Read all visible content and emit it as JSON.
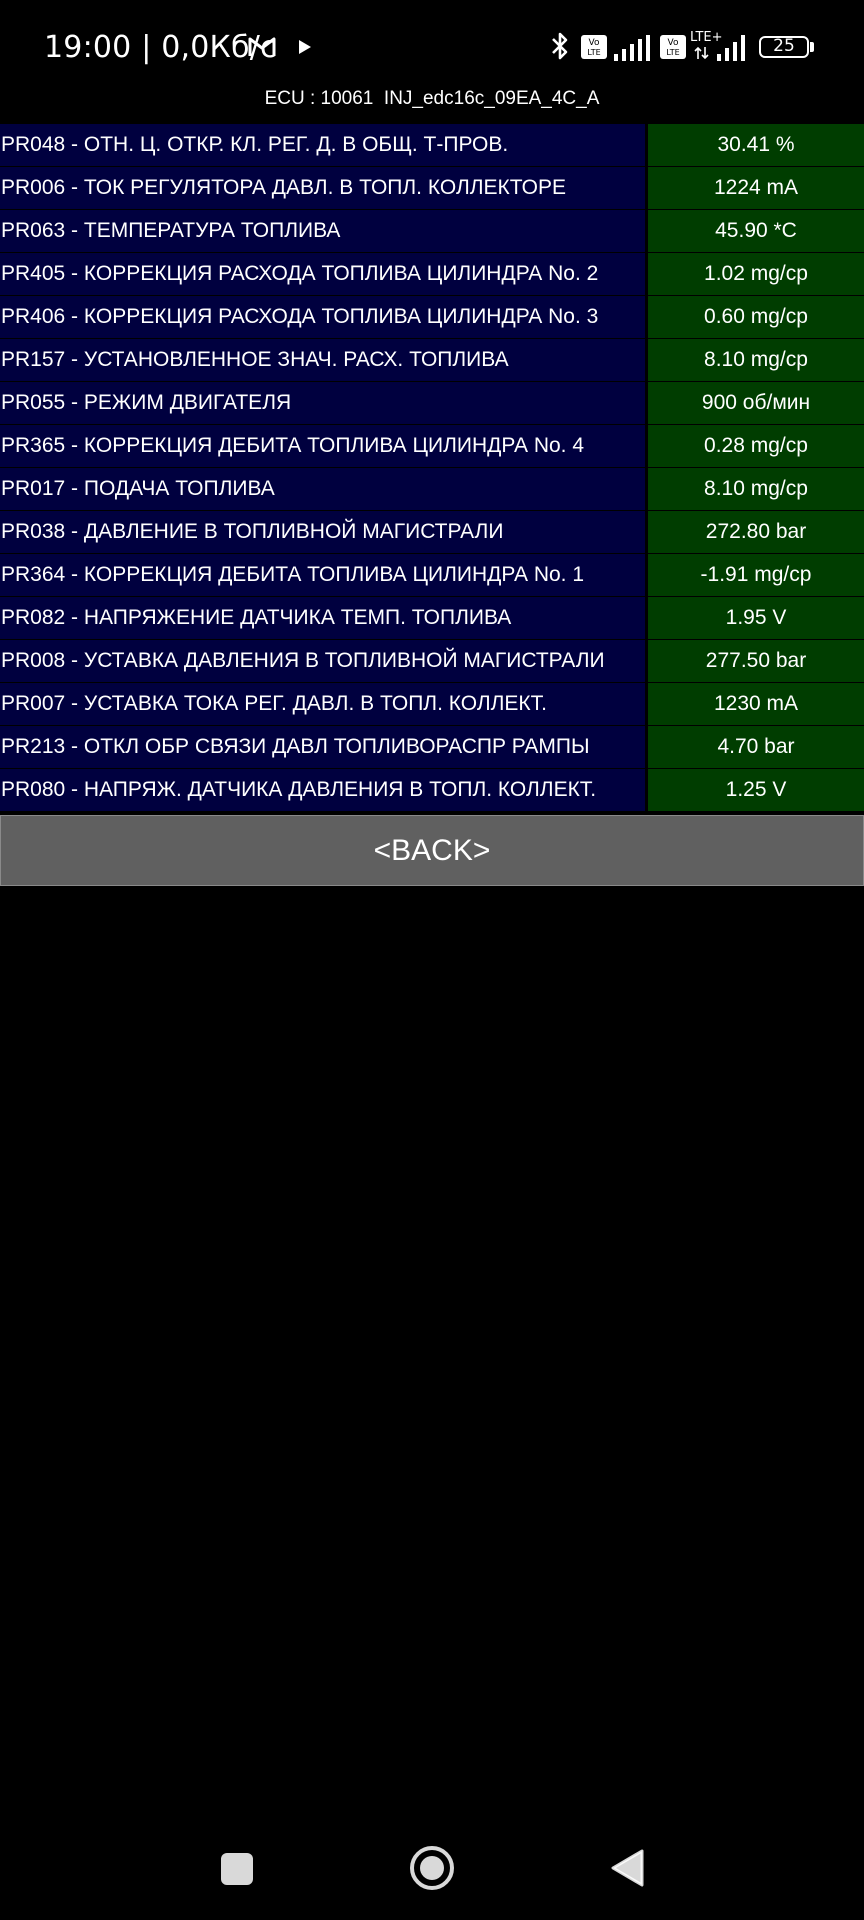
{
  "status_bar": {
    "time_text": "19:00 | 0,0Кб/с",
    "lte_label": "LTE+",
    "battery_level": "25",
    "icons": [
      "gmail-icon",
      "play-icon",
      "bluetooth-icon",
      "volte-icon",
      "signal-icon",
      "volte-icon",
      "lte-plus-icon",
      "signal-icon",
      "battery-icon"
    ]
  },
  "ecu_header": "ECU : 10061  INJ_edc16c_09EA_4C_A",
  "params": [
    {
      "name": "PR048 - ОТН. Ц. ОТКР. КЛ. РЕГ. Д. В ОБЩ. Т-ПРОВ.",
      "value": "30.41 %"
    },
    {
      "name": "PR006 - ТОК РЕГУЛЯТОРА ДАВЛ. В ТОПЛ. КОЛЛЕКТОРЕ",
      "value": "1224 mA"
    },
    {
      "name": "PR063 - ТЕМПЕРАТУРА ТОПЛИВА",
      "value": "45.90 *C"
    },
    {
      "name": "PR405 - КОРРЕКЦИЯ РАСХОДА ТОПЛИВА ЦИЛИНДРА No. 2",
      "value": "1.02 mg/cp"
    },
    {
      "name": "PR406 - КОРРЕКЦИЯ РАСХОДА ТОПЛИВА ЦИЛИНДРА No. 3",
      "value": "0.60 mg/cp"
    },
    {
      "name": "PR157 - УСТАНОВЛЕННОЕ ЗНАЧ. РАСХ. ТОПЛИВА",
      "value": "8.10 mg/cp"
    },
    {
      "name": "PR055 - РЕЖИМ ДВИГАТЕЛЯ",
      "value": "900 об/мин"
    },
    {
      "name": "PR365 - КОРРЕКЦИЯ ДЕБИТА ТОПЛИВА ЦИЛИНДРА No. 4",
      "value": "0.28 mg/cp"
    },
    {
      "name": "PR017 - ПОДАЧА ТОПЛИВА",
      "value": "8.10 mg/cp"
    },
    {
      "name": "PR038 - ДАВЛЕНИЕ В ТОПЛИВНОЙ МАГИСТРАЛИ",
      "value": "272.80 bar"
    },
    {
      "name": "PR364 - КОРРЕКЦИЯ ДЕБИТА ТОПЛИВА ЦИЛИНДРА No. 1",
      "value": "-1.91 mg/cp"
    },
    {
      "name": "PR082 - НАПРЯЖЕНИЕ ДАТЧИКА ТЕМП. ТОПЛИВА",
      "value": "1.95 V"
    },
    {
      "name": "PR008 - УСТАВКА ДАВЛЕНИЯ В ТОПЛИВНОЙ МАГИСТРАЛИ",
      "value": "277.50 bar"
    },
    {
      "name": "PR007 - УСТАВКА ТОКА РЕГ. ДАВЛ. В ТОПЛ. КОЛЛЕКТ.",
      "value": "1230 mA"
    },
    {
      "name": "PR213 - ОТКЛ ОБР СВЯЗИ ДАВЛ ТОПЛИВОРАСПР РАМПЫ",
      "value": "4.70 bar"
    },
    {
      "name": "PR080 - НАПРЯЖ. ДАТЧИКА ДАВЛЕНИЯ В ТОПЛ. КОЛЛЕКТ.",
      "value": "1.25 V"
    }
  ],
  "back_button": {
    "label": "<BACK>"
  },
  "nav_bar": {
    "icons": [
      "recents-square-icon",
      "home-circle-icon",
      "back-triangle-icon"
    ]
  },
  "colors": {
    "background": "#000000",
    "param_name_bg": "#00003f",
    "param_value_bg": "#003d00",
    "back_button_bg": "#606060",
    "text": "#ffffff"
  }
}
